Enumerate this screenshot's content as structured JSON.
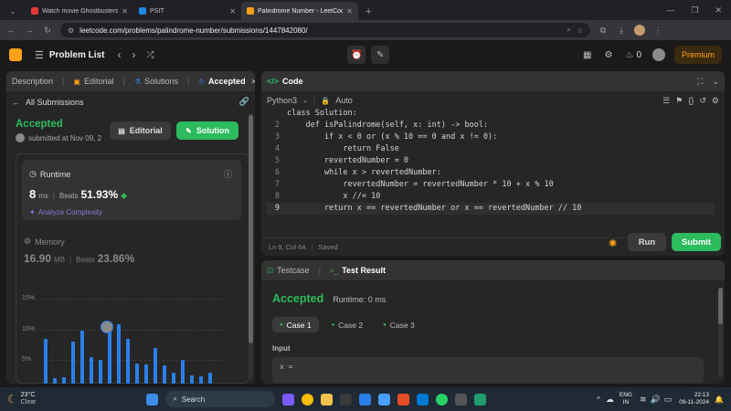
{
  "browser": {
    "tabs": [
      {
        "title": "Watch movie Ghostbusters: Fro",
        "color": "#e53935"
      },
      {
        "title": "PSIT",
        "color": "#1e88e5"
      },
      {
        "title": "Palindrome Number - LeetCode",
        "color": "#ffa116"
      }
    ],
    "url": "leetcode.com/problems/palindrome-number/submissions/1447842080/"
  },
  "header": {
    "problem_list": "Problem List",
    "streak": "0",
    "premium": "Premium"
  },
  "left": {
    "tabs": [
      "Description",
      "Editorial",
      "Solutions",
      "Accepted"
    ],
    "all_submissions": "All Submissions",
    "status": "Accepted",
    "submitted": "submitted at Nov 09, 2",
    "editorial_btn": "Editorial",
    "solution_btn": "Solution",
    "runtime": {
      "label": "Runtime",
      "value": "8",
      "unit": "ms",
      "beats_label": "Beats",
      "beats": "51.93%",
      "analyze": "Analyze Complexity"
    },
    "memory": {
      "label": "Memory",
      "value": "16.90",
      "unit": "MB",
      "beats_label": "Beats",
      "beats": "23.86%"
    },
    "chart_data": {
      "type": "bar",
      "yticks": [
        "15%",
        "10%",
        "5%"
      ],
      "ylim": [
        0,
        16
      ],
      "values": [
        7.5,
        1,
        1.2,
        7,
        8.8,
        4.5,
        4,
        9.6,
        9.8,
        7.5,
        3.5,
        3.3,
        6,
        3.2,
        2,
        4,
        1.5,
        1.4,
        2
      ]
    }
  },
  "code": {
    "title": "Code",
    "language": "Python3",
    "auto": "Auto",
    "lines": [
      "class Solution:",
      "    def isPalindrome(self, x: int) -> bool:",
      "        if x < 0 or (x % 10 == 0 and x != 0):",
      "            return False",
      "        revertedNumber = 0",
      "        while x > revertedNumber:",
      "            revertedNumber = revertedNumber * 10 + x % 10",
      "            x //= 10",
      "        return x == revertedNumber or x == revertedNumber // 10"
    ],
    "line_numbers": [
      "",
      "2",
      "3",
      "4",
      "5",
      "6",
      "7",
      "8",
      "9"
    ],
    "status": "Ln 9, Col 64",
    "saved": "Saved",
    "run": "Run",
    "submit": "Submit"
  },
  "result": {
    "tab_testcase": "Testcase",
    "tab_result": "Test Result",
    "status": "Accepted",
    "runtime": "Runtime: 0 ms",
    "cases": [
      "Case 1",
      "Case 2",
      "Case 3"
    ],
    "input_label": "Input",
    "input_var": "x ="
  },
  "taskbar": {
    "temp": "23°C",
    "weather": "Clear",
    "search": "Search",
    "lang1": "ENG",
    "lang2": "IN",
    "time": "22:13",
    "date": "09-11-2024"
  }
}
